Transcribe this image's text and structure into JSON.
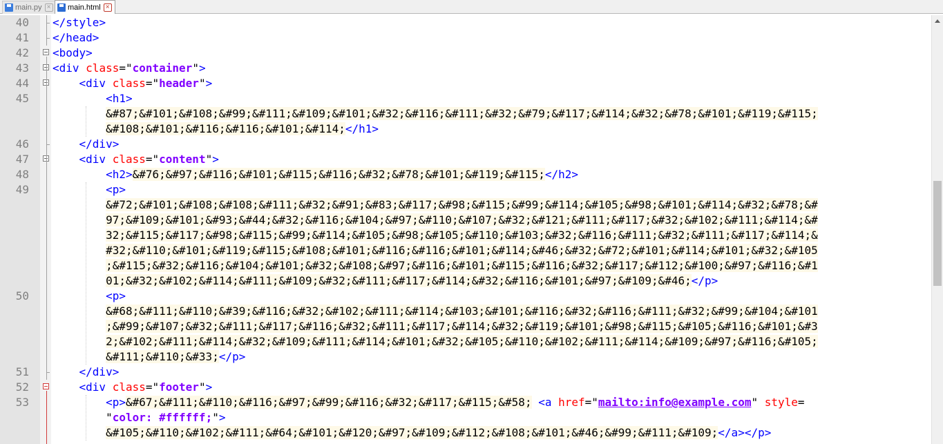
{
  "tabs": [
    {
      "label": "main.py",
      "active": false
    },
    {
      "label": "main.html",
      "active": true
    }
  ],
  "editor": {
    "lines": [
      {
        "n": "40",
        "code": "</style>"
      },
      {
        "n": "41",
        "code": "</head>"
      },
      {
        "n": "42",
        "code": "<body>"
      },
      {
        "n": "43",
        "code": "<div class=\"container\">"
      },
      {
        "n": "44",
        "code": "    <div class=\"header\">"
      },
      {
        "n": "45",
        "code": "        <h1>"
      },
      {
        "n": "",
        "code": "        &#87;&#101;&#108;&#99;&#111;&#109;&#101;&#32;&#116;&#111;&#32;&#79;&#117;&#114;&#32;&#78;&#101;&#119;&#115;"
      },
      {
        "n": "",
        "code": "        &#108;&#101;&#116;&#116;&#101;&#114;</h1>"
      },
      {
        "n": "46",
        "code": "    </div>"
      },
      {
        "n": "47",
        "code": "    <div class=\"content\">"
      },
      {
        "n": "48",
        "code": "        <h2>&#76;&#97;&#116;&#101;&#115;&#116;&#32;&#78;&#101;&#119;&#115;</h2>"
      },
      {
        "n": "49",
        "code": "        <p>"
      },
      {
        "n": "",
        "code": "        &#72;&#101;&#108;&#108;&#111;&#32;&#91;&#83;&#117;&#98;&#115;&#99;&#114;&#105;&#98;&#101;&#114;&#32;&#78;&#"
      },
      {
        "n": "",
        "code": "        97;&#109;&#101;&#93;&#44;&#32;&#116;&#104;&#97;&#110;&#107;&#32;&#121;&#111;&#117;&#32;&#102;&#111;&#114;&#"
      },
      {
        "n": "",
        "code": "        32;&#115;&#117;&#98;&#115;&#99;&#114;&#105;&#98;&#105;&#110;&#103;&#32;&#116;&#111;&#32;&#111;&#117;&#114;&"
      },
      {
        "n": "",
        "code": "        #32;&#110;&#101;&#119;&#115;&#108;&#101;&#116;&#116;&#101;&#114;&#46;&#32;&#72;&#101;&#114;&#101;&#32;&#105"
      },
      {
        "n": "",
        "code": "        ;&#115;&#32;&#116;&#104;&#101;&#32;&#108;&#97;&#116;&#101;&#115;&#116;&#32;&#117;&#112;&#100;&#97;&#116;&#1"
      },
      {
        "n": "",
        "code": "        01;&#32;&#102;&#114;&#111;&#109;&#32;&#111;&#117;&#114;&#32;&#116;&#101;&#97;&#109;&#46;</p>"
      },
      {
        "n": "50",
        "code": "        <p>"
      },
      {
        "n": "",
        "code": "        &#68;&#111;&#110;&#39;&#116;&#32;&#102;&#111;&#114;&#103;&#101;&#116;&#32;&#116;&#111;&#32;&#99;&#104;&#101"
      },
      {
        "n": "",
        "code": "        ;&#99;&#107;&#32;&#111;&#117;&#116;&#32;&#111;&#117;&#114;&#32;&#119;&#101;&#98;&#115;&#105;&#116;&#101;&#3"
      },
      {
        "n": "",
        "code": "        2;&#102;&#111;&#114;&#32;&#109;&#111;&#114;&#101;&#32;&#105;&#110;&#102;&#111;&#114;&#109;&#97;&#116;&#105;"
      },
      {
        "n": "",
        "code": "        &#111;&#110;&#33;</p>"
      },
      {
        "n": "51",
        "code": "    </div>"
      },
      {
        "n": "52",
        "code": "    <div class=\"footer\">"
      },
      {
        "n": "53",
        "code": "        <p>&#67;&#111;&#110;&#116;&#97;&#99;&#116;&#32;&#117;&#115;&#58; <a href=\"mailto:info@example.com\" style="
      },
      {
        "n": "",
        "code": "        \"color: #ffffff;\">"
      },
      {
        "n": "",
        "code": "        &#105;&#110;&#102;&#111;&#64;&#101;&#120;&#97;&#109;&#112;&#108;&#101;&#46;&#99;&#111;&#109;</a></p>"
      }
    ]
  }
}
